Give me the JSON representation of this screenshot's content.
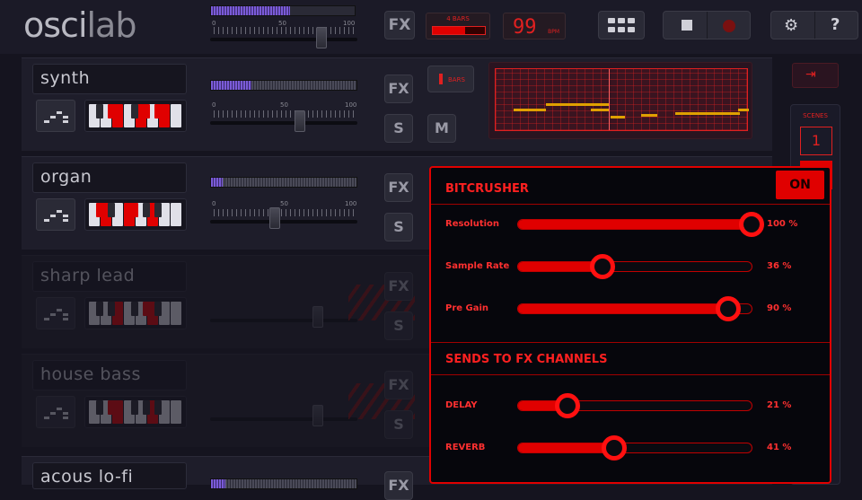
{
  "app": {
    "logo_prefix": "osci",
    "logo_suffix": "lab"
  },
  "topbar": {
    "fx_label": "FX",
    "bars_label": "4 BARS",
    "bars_progress": 0.62,
    "bpm_value": "99",
    "bpm_unit": "BPM",
    "master_meter_level": 0.55,
    "master_slider_level": 0.85,
    "tick_0": "0",
    "tick_50": "50",
    "tick_100": "100"
  },
  "tracks": [
    {
      "name": "synth",
      "meter_level": 0.28,
      "slider_level": 0.62,
      "fx": "FX",
      "solo": "S",
      "mute": "M",
      "bars_label": "BARS"
    },
    {
      "name": "organ",
      "meter_level": 0.08,
      "slider_level": 0.45,
      "fx": "FX",
      "solo": "S"
    },
    {
      "name": "sharp lead",
      "fx": "FX",
      "solo": "S"
    },
    {
      "name": "house bass",
      "fx": "FX",
      "solo": "S"
    },
    {
      "name": "acous lo-fi",
      "fx": "FX"
    }
  ],
  "side": {
    "scenes_label": "SCENES",
    "scene_1": "1"
  },
  "bitcrusher": {
    "title": "BITCRUSHER",
    "on_label": "ON",
    "params": [
      {
        "label": "Resolution",
        "value": 100,
        "value_text": "100 %"
      },
      {
        "label": "Sample Rate",
        "value": 36,
        "value_text": "36 %"
      },
      {
        "label": "Pre Gain",
        "value": 90,
        "value_text": "90 %"
      }
    ],
    "sends_title": "SENDS TO FX CHANNELS",
    "sends": [
      {
        "label": "DELAY",
        "value": 21,
        "value_text": "21 %"
      },
      {
        "label": "REVERB",
        "value": 41,
        "value_text": "41 %"
      }
    ]
  },
  "colors": {
    "accent": "#e00000",
    "background": "#15141f",
    "meter": "#7a5bd8",
    "note": "#e0a000"
  }
}
